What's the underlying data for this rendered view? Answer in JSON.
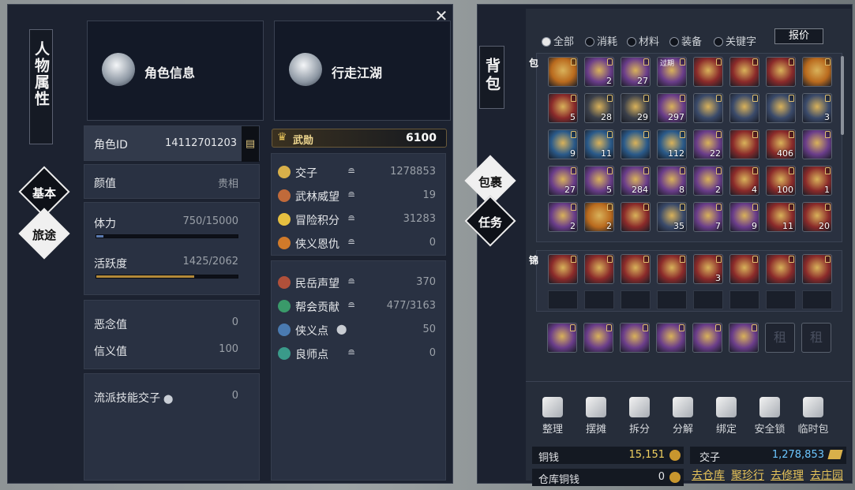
{
  "left_panel": {
    "title": "人物属性",
    "nav": {
      "basic": "基本",
      "journey": "旅途"
    },
    "cards": [
      {
        "label": "角色信息",
        "icon": "role-info-icon"
      },
      {
        "label": "行走江湖",
        "icon": "gourd-icon"
      }
    ],
    "stats": {
      "role_id_label": "角色ID",
      "role_id": "14112701203",
      "appearance_label": "颜值",
      "appearance_value": "贵相",
      "stamina_label": "体力",
      "stamina_value": "750/15000",
      "stamina_fraction": 0.05,
      "activity_label": "活跃度",
      "activity_value": "1425/2062",
      "activity_fraction": 0.691,
      "evil_label": "恶念值",
      "evil_value": "0",
      "trust_label": "信义值",
      "trust_value": "100",
      "school_label": "流派技能交子",
      "school_value": "0"
    },
    "wuxun": {
      "label": "武勋",
      "value": "6100"
    },
    "currencies": [
      {
        "label": "交子",
        "value": "1278853",
        "icon": "jiaozi-icon",
        "color": "#d8b04a"
      },
      {
        "label": "武林威望",
        "value": "19",
        "icon": "sword-icon",
        "color": "#c06a3a"
      },
      {
        "label": "冒险积分",
        "value": "31283",
        "icon": "coin-icon",
        "color": "#e6c040"
      },
      {
        "label": "侠义恩仇",
        "value": "0",
        "icon": "flame-icon",
        "color": "#d07a2a"
      }
    ],
    "reputations": [
      {
        "label": "民岳声望",
        "value": "370",
        "icon": "min-icon",
        "color": "#b0503a"
      },
      {
        "label": "帮会贡献",
        "value": "477/3163",
        "icon": "gong-icon",
        "color": "#3a9a6a"
      },
      {
        "label": "侠义点",
        "value": "50",
        "icon": "xia-icon",
        "color": "#4a7ab0"
      },
      {
        "label": "良师点",
        "value": "0",
        "icon": "shi-icon",
        "color": "#3a9a8a"
      }
    ]
  },
  "right_panel": {
    "title": "背包",
    "nav": {
      "bag": "包裹",
      "task": "任务"
    },
    "filters": [
      "全部",
      "消耗",
      "材料",
      "装备",
      "关键字"
    ],
    "price_button": "报价",
    "bag_tag": "包",
    "brocade_tag": "锦",
    "items": [
      {
        "c": "#b96a1e",
        "q": ""
      },
      {
        "c": "#6a3d8a",
        "q": "2"
      },
      {
        "c": "#6a3d8a",
        "q": "27"
      },
      {
        "c": "#6a3d8a",
        "q": "",
        "tag": "过期"
      },
      {
        "c": "#8a2a2a",
        "q": ""
      },
      {
        "c": "#8a2a2a",
        "q": ""
      },
      {
        "c": "#8a2a2a",
        "q": ""
      },
      {
        "c": "#b96a1e",
        "q": ""
      },
      {
        "c": "#8a2a2a",
        "q": "5"
      },
      {
        "c": "#3a3f4a",
        "q": "28"
      },
      {
        "c": "#3a3f4a",
        "q": "29"
      },
      {
        "c": "#6a3d8a",
        "q": "297"
      },
      {
        "c": "#3a4a6a",
        "q": ""
      },
      {
        "c": "#3a4a6a",
        "q": ""
      },
      {
        "c": "#3a4a6a",
        "q": ""
      },
      {
        "c": "#3a4a6a",
        "q": "3"
      },
      {
        "c": "#2a5a8a",
        "q": "9"
      },
      {
        "c": "#2a5a8a",
        "q": "11"
      },
      {
        "c": "#2a5a8a",
        "q": ""
      },
      {
        "c": "#2a5a8a",
        "q": "112"
      },
      {
        "c": "#6a3d8a",
        "q": "22"
      },
      {
        "c": "#8a2a2a",
        "q": ""
      },
      {
        "c": "#8a2a2a",
        "q": "406"
      },
      {
        "c": "#6a3d8a",
        "q": ""
      },
      {
        "c": "#6a3d8a",
        "q": "27"
      },
      {
        "c": "#6a3d8a",
        "q": "5"
      },
      {
        "c": "#6a3d8a",
        "q": "284"
      },
      {
        "c": "#6a3d8a",
        "q": "8"
      },
      {
        "c": "#6a3d8a",
        "q": "2"
      },
      {
        "c": "#8a2a2a",
        "q": "4"
      },
      {
        "c": "#8a2a2a",
        "q": "100"
      },
      {
        "c": "#8a2a2a",
        "q": "1"
      },
      {
        "c": "#6a3d8a",
        "q": "2"
      },
      {
        "c": "#b96a1e",
        "q": "2"
      },
      {
        "c": "#8a2a2a",
        "q": ""
      },
      {
        "c": "#3a4a6a",
        "q": "35"
      },
      {
        "c": "#6a3d8a",
        "q": "7"
      },
      {
        "c": "#6a3d8a",
        "q": "9"
      },
      {
        "c": "#8a2a2a",
        "q": "11"
      },
      {
        "c": "#8a2a2a",
        "q": "20"
      }
    ],
    "brocade_items": [
      {
        "c": "#8a2a2a",
        "q": ""
      },
      {
        "c": "#8a2a2a",
        "q": ""
      },
      {
        "c": "#8a2a2a",
        "q": ""
      },
      {
        "c": "#8a2a2a",
        "q": ""
      },
      {
        "c": "#8a2a2a",
        "q": "3"
      },
      {
        "c": "#8a2a2a",
        "q": ""
      },
      {
        "c": "#8a2a2a",
        "q": ""
      },
      {
        "c": "#8a2a2a",
        "q": ""
      }
    ],
    "extra_items": [
      {
        "c": "#6a3d8a",
        "q": ""
      },
      {
        "c": "#6a3d8a",
        "q": ""
      },
      {
        "c": "#6a3d8a",
        "q": ""
      },
      {
        "c": "#6a3d8a",
        "q": ""
      },
      {
        "c": "#6a3d8a",
        "q": ""
      },
      {
        "c": "#6a3d8a",
        "q": ""
      }
    ],
    "locked_slot_label": "租",
    "tools": [
      {
        "label": "整理",
        "icon": "sort-icon"
      },
      {
        "label": "摆摊",
        "icon": "stall-icon"
      },
      {
        "label": "拆分",
        "icon": "split-icon"
      },
      {
        "label": "分解",
        "icon": "decompose-icon"
      },
      {
        "label": "绑定",
        "icon": "bind-icon"
      },
      {
        "label": "安全锁",
        "icon": "lock-icon"
      },
      {
        "label": "临时包",
        "icon": "temp-bag-icon"
      }
    ],
    "money": {
      "copper_label": "铜钱",
      "copper": "15,151",
      "jiaozi_label": "交子",
      "jiaozi": "1,278,853",
      "store_label": "仓库铜钱",
      "store": "0"
    },
    "links": [
      "去仓库",
      "聚珍行",
      "去修理",
      "去庄园"
    ]
  }
}
